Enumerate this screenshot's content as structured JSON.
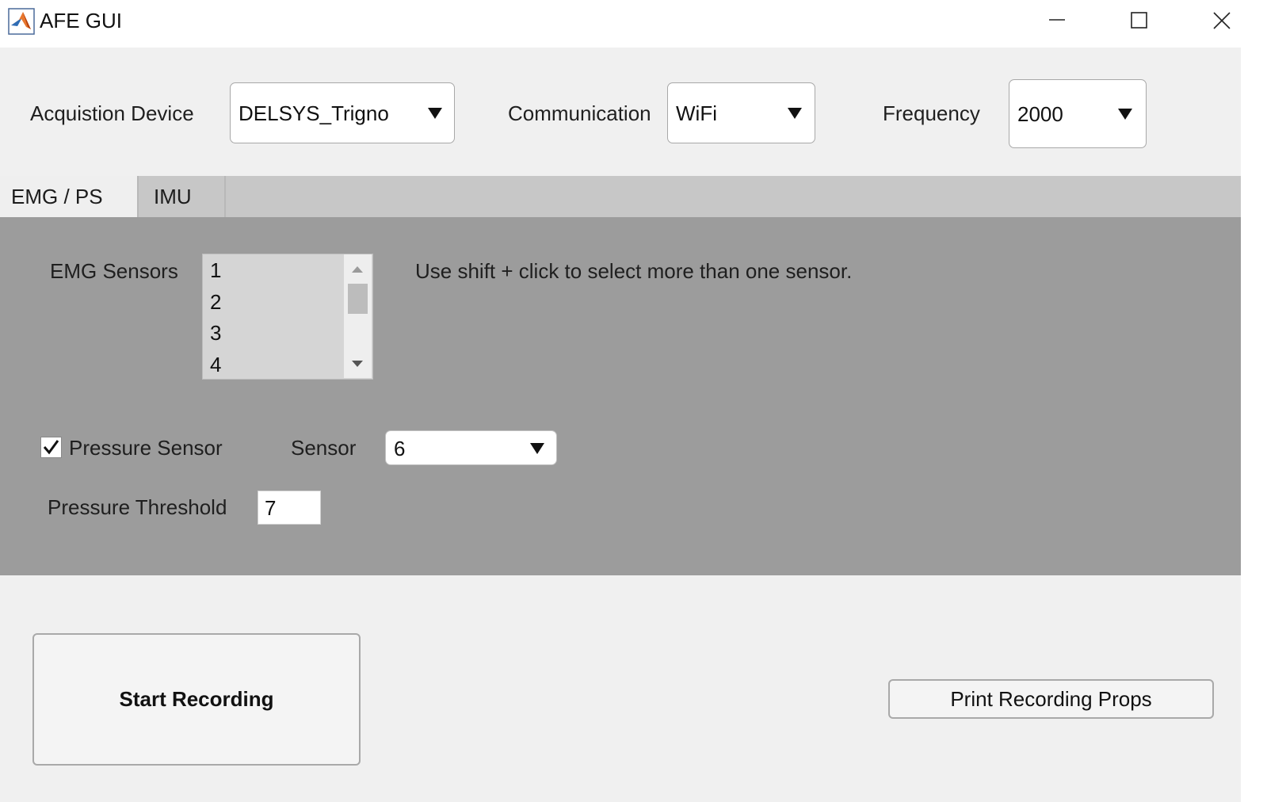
{
  "window": {
    "title": "AFE GUI",
    "app_icon": "matlab-icon",
    "controls": [
      "minimize-icon",
      "maximize-icon",
      "close-icon"
    ]
  },
  "top_controls": {
    "device_label": "Acquistion Device",
    "device_value": "DELSYS_Trigno",
    "communication_label": "Communication",
    "communication_value": "WiFi",
    "frequency_label": "Frequency",
    "frequency_value": "2000"
  },
  "tabs": [
    {
      "label": "EMG / PS",
      "selected": true
    },
    {
      "label": "IMU",
      "selected": false
    }
  ],
  "emg_panel": {
    "sensors_label": "EMG Sensors",
    "sensors": [
      "1",
      "2",
      "3",
      "4"
    ],
    "hint": "Use shift + click to select more than one sensor.",
    "pressure_checkbox_label": "Pressure Sensor",
    "pressure_checked": true,
    "sensor_label": "Sensor",
    "sensor_value": "6",
    "threshold_label": "Pressure Threshold",
    "threshold_value": "7"
  },
  "buttons": {
    "start": "Start Recording",
    "print": "Print Recording Props"
  },
  "colors": {
    "window_bg": "#f0f0f0",
    "panel_bg": "#9c9c9c",
    "tabstrip_bg": "#c7c7c7",
    "listbox_bg": "#d5d5d5"
  }
}
